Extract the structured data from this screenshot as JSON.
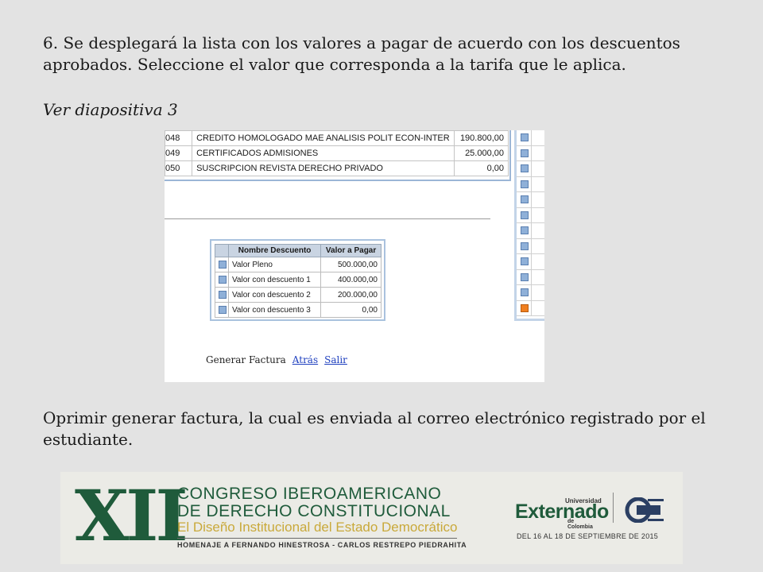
{
  "slide": {
    "paragraph_1": "6. Se desplegará la lista con los valores a pagar de acuerdo con los descuentos aprobados. Seleccione el valor que corresponda a la tarifa que le aplica.",
    "paragraph_2": "Ver diapositiva 3",
    "paragraph_3": "Oprimir generar factura, la cual es enviada al correo electrónico registrado por el estudiante."
  },
  "screenshot": {
    "top_rows": [
      {
        "code": "048",
        "description": "CREDITO HOMOLOGADO MAE ANALISIS POLIT ECON-INTER",
        "value": "190.800,00"
      },
      {
        "code": "049",
        "description": "CERTIFICADOS ADMISIONES",
        "value": "25.000,00"
      },
      {
        "code": "050",
        "description": "SUSCRIPCION REVISTA DERECHO PRIVADO",
        "value": "0,00"
      }
    ],
    "discounts": {
      "header_name": "Nombre Descuento",
      "header_value": "Valor a Pagar",
      "rows": [
        {
          "name": "Valor Pleno",
          "value": "500.000,00"
        },
        {
          "name": "Valor con descuento 1",
          "value": "400.000,00"
        },
        {
          "name": "Valor con descuento 2",
          "value": "200.000,00"
        },
        {
          "name": "Valor con descuento 3",
          "value": "0,00"
        }
      ]
    },
    "actions": {
      "generate": "Generar Factura",
      "back": "Atrás",
      "exit": "Salir"
    },
    "checkbox_color": "#8fb0d8",
    "selected_checkbox_color": "#f07f1f"
  },
  "banner": {
    "numeral": "XII",
    "line1": "CONGRESO IBEROAMERICANO",
    "line2": "DE DERECHO CONSTITUCIONAL",
    "line3": "El Diseño Institucional del Estado Democrático",
    "line4": "HOMENAJE A FERNANDO HINESTROSA - CARLOS RESTREPO PIEDRAHITA",
    "logo_top": "Universidad",
    "logo_main": "Externado",
    "logo_bottom": "de Colombia",
    "dates": "DEL 16 AL 18 DE SEPTIEMBRE DE 2015",
    "accent_green": "#1f5b3b",
    "accent_gold": "#c9a93a"
  }
}
